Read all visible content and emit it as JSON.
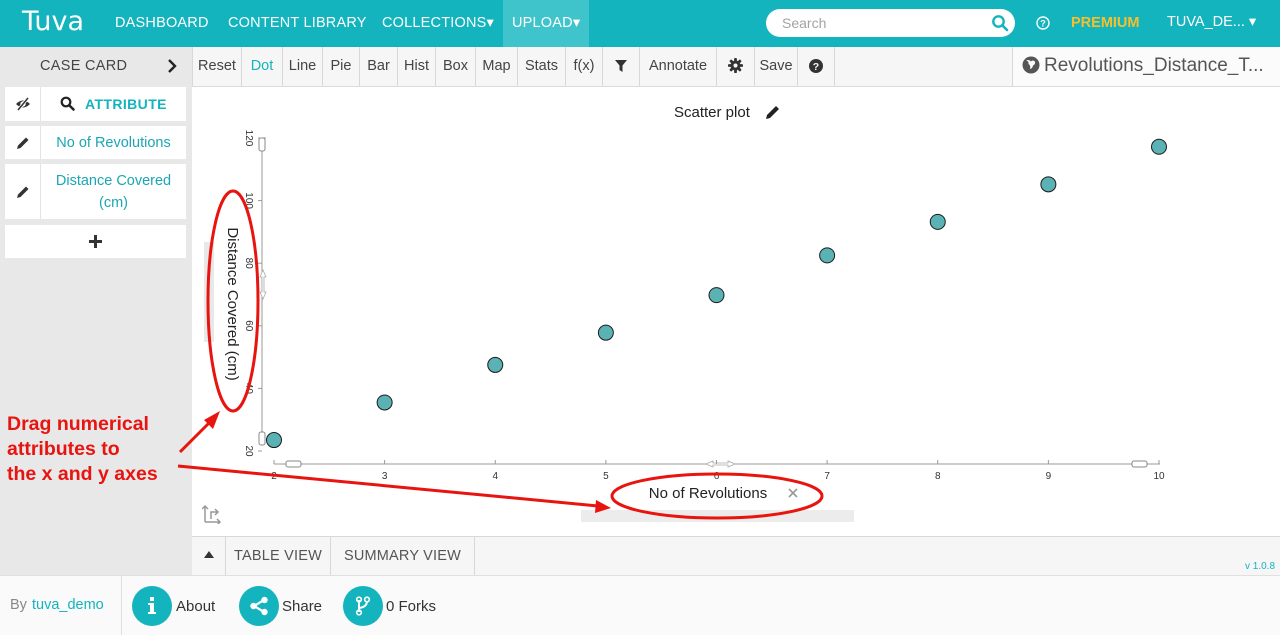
{
  "app": {
    "logo": "Tuva"
  },
  "nav": {
    "dashboard": "DASHBOARD",
    "content_library": "CONTENT LIBRARY",
    "collections": "COLLECTIONS▾",
    "upload": "UPLOAD▾",
    "search_placeholder": "Search",
    "premium": "PREMIUM",
    "user": "TUVA_DE... ▾"
  },
  "toolbar": {
    "case_card": "CASE CARD",
    "reset": "Reset",
    "dot": "Dot",
    "line": "Line",
    "pie": "Pie",
    "bar": "Bar",
    "hist": "Hist",
    "box": "Box",
    "map": "Map",
    "stats": "Stats",
    "fx": "f(x)",
    "annotate": "Annotate",
    "save": "Save",
    "doc_title": "Revolutions_Distance_T..."
  },
  "sidebar": {
    "header": "ATTRIBUTE",
    "attributes": [
      {
        "label": "No of Revolutions"
      },
      {
        "label": "Distance Covered (cm)"
      }
    ]
  },
  "plot": {
    "title": "Scatter plot",
    "x_axis_label": "No of Revolutions",
    "y_axis_label": "Distance Covered (cm)"
  },
  "chart_data": {
    "type": "scatter",
    "title": "Scatter plot",
    "xlabel": "No of Revolutions",
    "ylabel": "Distance Covered (cm)",
    "xlim": [
      2,
      10
    ],
    "ylim": [
      20,
      120
    ],
    "x_ticks": [
      2,
      3,
      4,
      5,
      6,
      7,
      8,
      9,
      10
    ],
    "y_ticks": [
      20,
      40,
      60,
      80,
      100,
      120
    ],
    "x_tick_labels": [
      "2",
      "3",
      "4",
      "5",
      "6",
      "7",
      "8",
      "9",
      "10"
    ],
    "y_tick_labels": [
      "20",
      "40",
      "60",
      "80",
      "100",
      "120"
    ],
    "point_color": "#5bb2b5",
    "points": [
      {
        "x": 2.0,
        "y": 23.5
      },
      {
        "x": 3.0,
        "y": 35.5
      },
      {
        "x": 4.0,
        "y": 47.5
      },
      {
        "x": 5.0,
        "y": 57.8
      },
      {
        "x": 6.0,
        "y": 69.8
      },
      {
        "x": 7.0,
        "y": 82.5
      },
      {
        "x": 8.0,
        "y": 93.2
      },
      {
        "x": 9.0,
        "y": 105.2
      },
      {
        "x": 10.0,
        "y": 117.2
      }
    ]
  },
  "bottom_tabs": {
    "table_view": "TABLE VIEW",
    "summary_view": "SUMMARY VIEW",
    "version": "v 1.0.8"
  },
  "footer": {
    "by": "By",
    "user": "tuva_demo",
    "about": "About",
    "share": "Share",
    "forks": "0 Forks"
  },
  "annotation": {
    "text_lines": [
      "Drag numerical",
      "attributes to",
      "the x and y axes"
    ],
    "color": "#e8140f"
  },
  "colors": {
    "brand": "#13b4bd",
    "premium": "#f7c02b"
  }
}
